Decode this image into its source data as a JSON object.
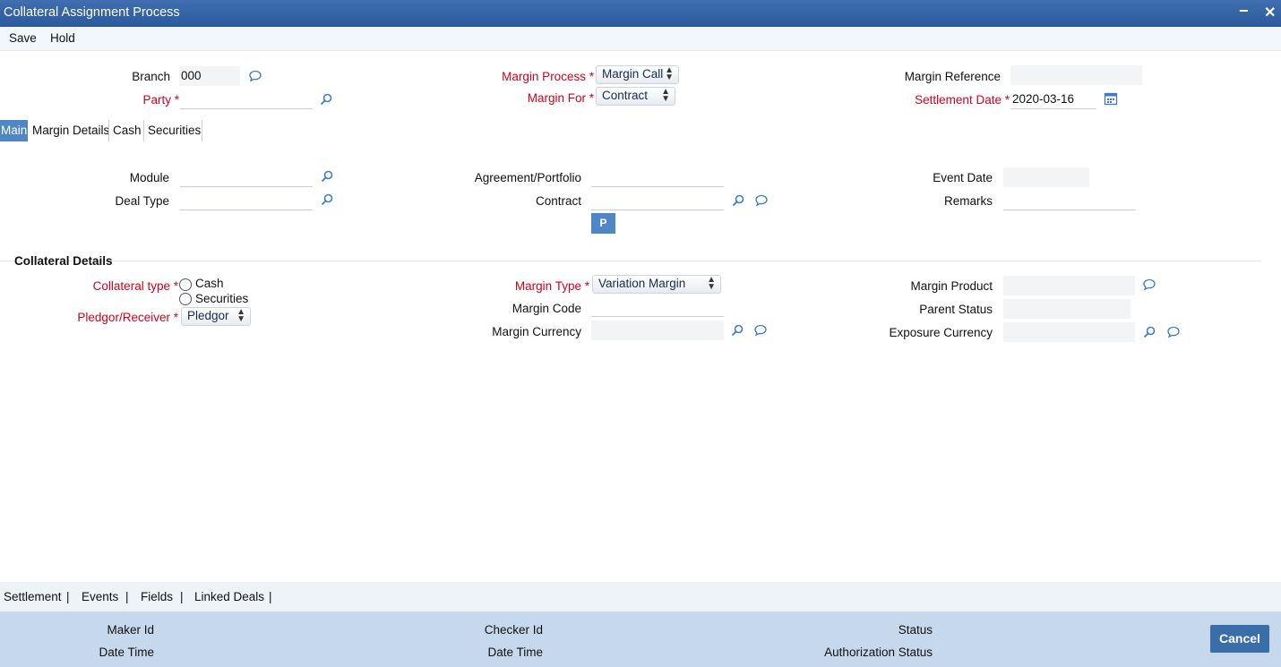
{
  "window": {
    "title": "Collateral Assignment Process",
    "minimize_glyph": "−",
    "close_glyph": "✕"
  },
  "menu": {
    "save": "Save",
    "hold": "Hold"
  },
  "header": {
    "branch_label": "Branch",
    "branch_value": "000",
    "party_label": "Party",
    "party_value": "",
    "margin_process_label": "Margin Process",
    "margin_process_value": "Margin Call",
    "margin_for_label": "Margin For",
    "margin_for_value": "Contract",
    "margin_reference_label": "Margin Reference",
    "margin_reference_value": "",
    "settlement_date_label": "Settlement Date",
    "settlement_date_value": "2020-03-16",
    "required_mark": "*"
  },
  "tabs": [
    {
      "label": "Main",
      "active": true
    },
    {
      "label": "Margin Details",
      "active": false
    },
    {
      "label": "Cash",
      "active": false
    },
    {
      "label": "Securities",
      "active": false
    }
  ],
  "main": {
    "module_label": "Module",
    "module_value": "",
    "deal_type_label": "Deal Type",
    "deal_type_value": "",
    "agreement_label": "Agreement/Portfolio",
    "agreement_value": "",
    "contract_label": "Contract",
    "contract_value": "",
    "p_button": "P",
    "event_date_label": "Event Date",
    "event_date_value": "",
    "remarks_label": "Remarks",
    "remarks_value": ""
  },
  "collateral": {
    "section_title": "Collateral Details",
    "collateral_type_label": "Collateral type",
    "option_cash": "Cash",
    "option_securities": "Securities",
    "pledgor_label": "Pledgor/Receiver",
    "pledgor_value": "Pledgor",
    "margin_type_label": "Margin Type",
    "margin_type_value": "Variation Margin",
    "margin_code_label": "Margin Code",
    "margin_code_value": "",
    "margin_currency_label": "Margin Currency",
    "margin_currency_value": "",
    "margin_product_label": "Margin Product",
    "margin_product_value": "",
    "parent_status_label": "Parent Status",
    "parent_status_value": "",
    "exposure_currency_label": "Exposure Currency",
    "exposure_currency_value": ""
  },
  "bottom_links": [
    "Settlement",
    "|",
    "Events",
    "|",
    "Fields",
    "|",
    "Linked Deals",
    "|"
  ],
  "footer": {
    "maker_id": "Maker Id",
    "date_time_1": "Date Time",
    "checker_id": "Checker Id",
    "date_time_2": "Date Time",
    "status": "Status",
    "authorization_status": "Authorization Status",
    "cancel": "Cancel"
  },
  "colors": {
    "title_bar": "#2c5a9c",
    "accent": "#4f86c6",
    "required": "#d0021b",
    "footer": "#c6d9ec"
  }
}
